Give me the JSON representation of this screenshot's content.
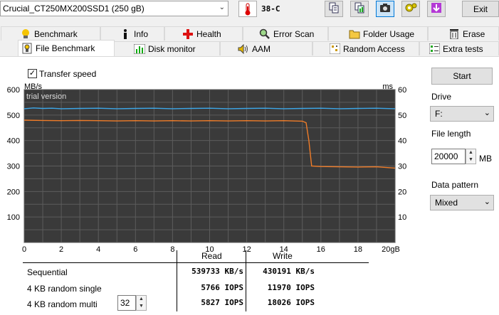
{
  "toolbar": {
    "drive": "Crucial_CT250MX200SSD1 (250 gB)",
    "temperature": "38-C",
    "exit_label": "Exit",
    "buttons": [
      "copy-icon",
      "copy-screenshot-icon",
      "camera-icon",
      "settings-icon",
      "download-icon"
    ]
  },
  "tabs_row1": [
    "Benchmark",
    "Info",
    "Health",
    "Error Scan",
    "Folder Usage",
    "Erase"
  ],
  "tabs_row2": [
    "File Benchmark",
    "Disk monitor",
    "AAM",
    "Random Access",
    "Extra tests"
  ],
  "active_tab": "File Benchmark",
  "transfer_speed_label": "Transfer speed",
  "transfer_speed_checked": true,
  "chart_data": {
    "type": "line",
    "watermark": "trial version",
    "left_axis_unit": "MB/s",
    "right_axis_unit": "ms",
    "x_axis_unit": "gB",
    "xlim": [
      0,
      20
    ],
    "ylim_left": [
      0,
      600
    ],
    "ylim_right": [
      0,
      60
    ],
    "x_ticks": [
      0,
      2,
      4,
      6,
      8,
      10,
      12,
      14,
      16,
      18,
      20
    ],
    "y_ticks_left": [
      100,
      200,
      300,
      400,
      500,
      600
    ],
    "y_ticks_right": [
      10,
      20,
      30,
      40,
      50,
      60
    ],
    "grid": true,
    "series": [
      {
        "color": "#3da7e8",
        "x": [
          0,
          0.5,
          1,
          1.5,
          2,
          3,
          4,
          5,
          6,
          7,
          8,
          9,
          10,
          11,
          12,
          13,
          14,
          15,
          16,
          17,
          18,
          19,
          20
        ],
        "values": [
          525,
          528,
          526,
          527,
          525,
          526,
          527,
          525,
          526,
          527,
          525,
          526,
          527,
          525,
          526,
          527,
          525,
          526,
          527,
          525,
          526,
          527,
          525
        ]
      },
      {
        "color": "#f07c28",
        "x": [
          0,
          1,
          2,
          3,
          4,
          5,
          6,
          7,
          8,
          9,
          10,
          11,
          12,
          13,
          14,
          15,
          15.2,
          15.35,
          15.5,
          16,
          17,
          18,
          19,
          20
        ],
        "values": [
          480,
          479,
          478,
          479,
          478,
          477,
          478,
          477,
          478,
          477,
          478,
          477,
          478,
          477,
          478,
          476,
          470,
          400,
          300,
          298,
          297,
          296,
          297,
          292
        ]
      }
    ]
  },
  "controls": {
    "start_label": "Start",
    "drive_label": "Drive",
    "drive_value": "F:",
    "file_length_label": "File length",
    "file_length_value": "20000",
    "file_length_unit": "MB",
    "data_pattern_label": "Data pattern",
    "data_pattern_value": "Mixed"
  },
  "results": {
    "header_read": "Read",
    "header_write": "Write",
    "queue_depth": "32",
    "rows": [
      {
        "label": "Sequential",
        "read": "539733 KB/s",
        "write": "430191 KB/s"
      },
      {
        "label": "4 KB random single",
        "read": "5766 IOPS",
        "write": "11970 IOPS"
      },
      {
        "label": "4 KB random multi",
        "read": "5827 IOPS",
        "write": "18026 IOPS"
      }
    ]
  }
}
